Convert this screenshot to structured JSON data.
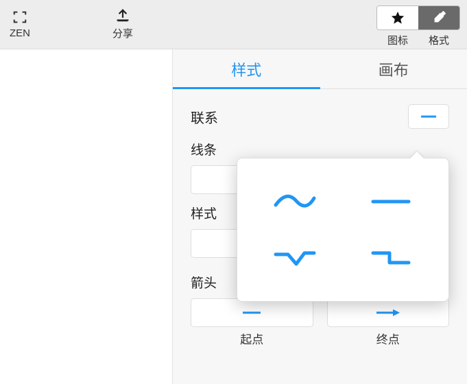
{
  "topbar": {
    "zen_label": "ZEN",
    "share_label": "分享",
    "icon_label": "图标",
    "format_label": "格式"
  },
  "tabs": {
    "style": "样式",
    "canvas": "画布"
  },
  "panel": {
    "relation_label": "联系",
    "line_label": "线条",
    "style_label": "样式",
    "arrow_label": "箭头",
    "start_label": "起点",
    "end_label": "终点"
  },
  "popover": {
    "options": [
      "wave",
      "straight",
      "zigzag",
      "bracket"
    ]
  },
  "colors": {
    "accent": "#2196f3",
    "topbar_bg": "#ededed",
    "panel_bg": "#f7f7f7",
    "seg_active": "#6a6a6a"
  }
}
